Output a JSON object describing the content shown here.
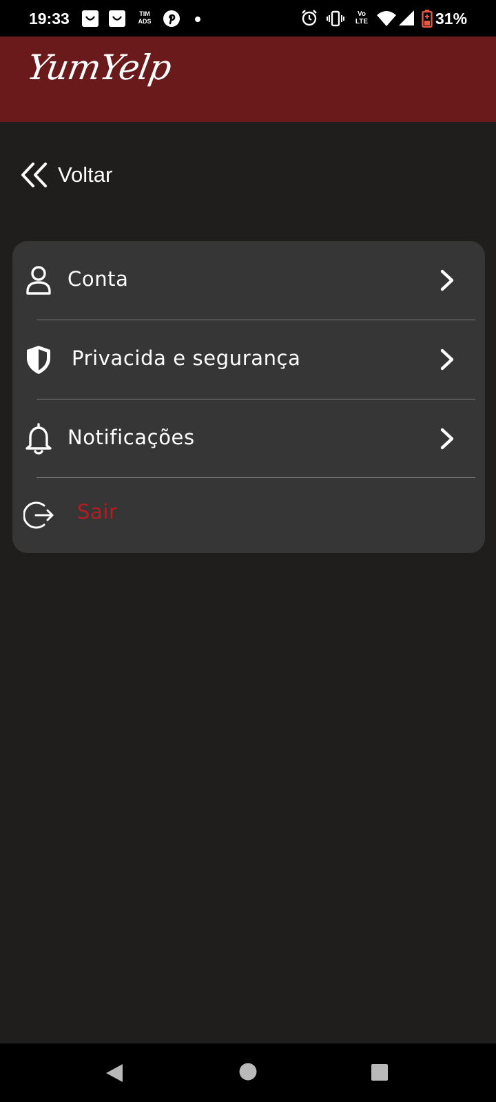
{
  "status_bar": {
    "time": "19:33",
    "carrier_badge": [
      "TIM",
      "ADS"
    ],
    "lte_badge": [
      "Vo",
      "LTE"
    ],
    "battery_percent": "31%",
    "battery_color": "#e5573f"
  },
  "header": {
    "logo_text": "YumYelp",
    "background_color": "#6a1a1b"
  },
  "back": {
    "label": "Voltar"
  },
  "menu": {
    "items": [
      {
        "label": "Conta",
        "icon": "user-icon"
      },
      {
        "label": "Privacida e segurança",
        "icon": "shield-icon"
      },
      {
        "label": "Notificações",
        "icon": "bell-icon"
      }
    ],
    "logout": {
      "label": "Sair",
      "icon": "logout-icon",
      "color": "#b21e22"
    }
  },
  "nav_bar": {
    "buttons": [
      "back-triangle-icon",
      "home-circle-icon",
      "recents-square-icon"
    ]
  }
}
